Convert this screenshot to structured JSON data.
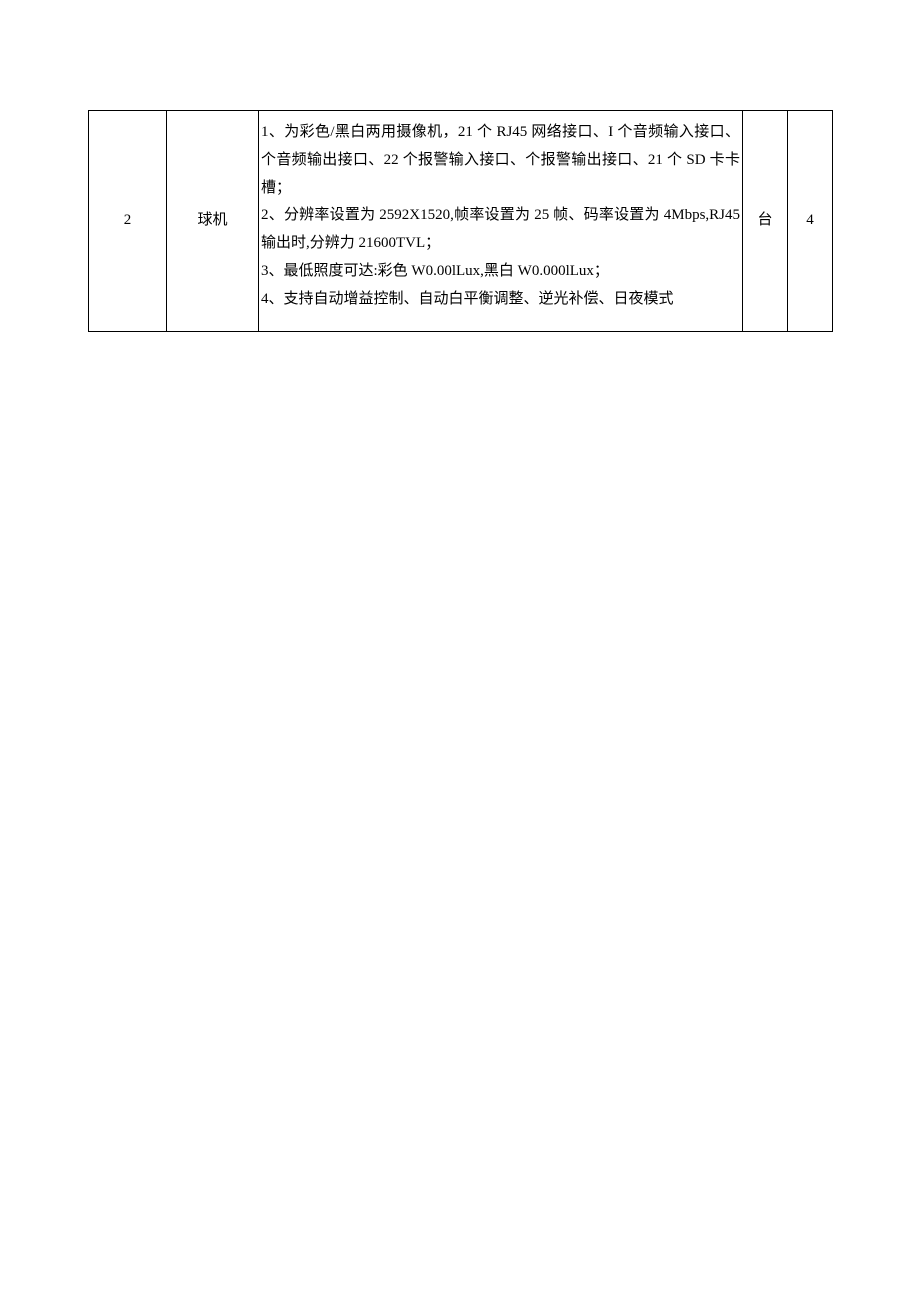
{
  "table": {
    "row": {
      "num": "2",
      "name": "球机",
      "desc_lines": [
        "1、为彩色/黑白两用摄像机，21 个 RJ45 网络接口、I 个音频输入接口、个音频输出接口、22 个报警输入接口、个报警输出接口、21 个 SD 卡卡槽；",
        "2、分辨率设置为 2592X1520,帧率设置为 25 帧、码率设置为 4Mbps,RJ45 输出时,分辨力 21600TVL；",
        "3、最低照度可达:彩色 W0.00lLux,黑白 W0.000lLux；",
        "4、支持自动增益控制、自动白平衡调整、逆光补偿、日夜模式"
      ],
      "unit": "台",
      "qty": "4"
    }
  }
}
